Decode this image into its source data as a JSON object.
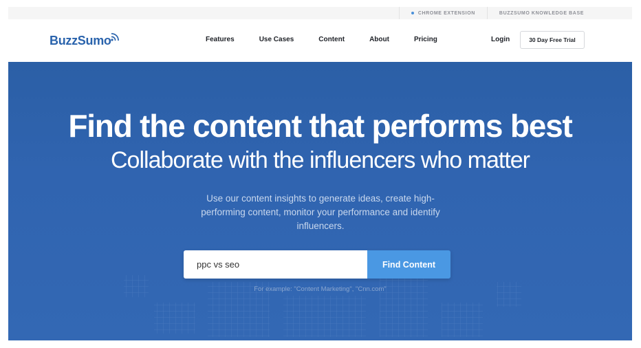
{
  "utility_bar": {
    "chrome_extension": "CHROME EXTENSION",
    "knowledge_base": "BUZZSUMO KNOWLEDGE BASE"
  },
  "nav": {
    "logo_text": "BuzzSumo",
    "links": [
      "Features",
      "Use Cases",
      "Content",
      "About",
      "Pricing"
    ],
    "login": "Login",
    "trial_button": "30 Day Free Trial"
  },
  "hero": {
    "headline": "Find the content that performs best",
    "subheadline": "Collaborate with the influencers who matter",
    "description": "Use our content insights to generate ideas, create high-performing content, monitor your performance and identify influencers.",
    "search": {
      "value": "ppc vs seo",
      "button_label": "Find Content"
    },
    "example": "For example: \"Content Marketing\", \"Cnn.com\""
  },
  "colors": {
    "brand": "#2a63ac",
    "hero_bg": "#3064b0",
    "button_blue": "#4a98e3",
    "bullet_dot": "#4a90d9"
  },
  "icons": [
    "logo-wifi-waves-icon",
    "bullet-dot-icon"
  ]
}
